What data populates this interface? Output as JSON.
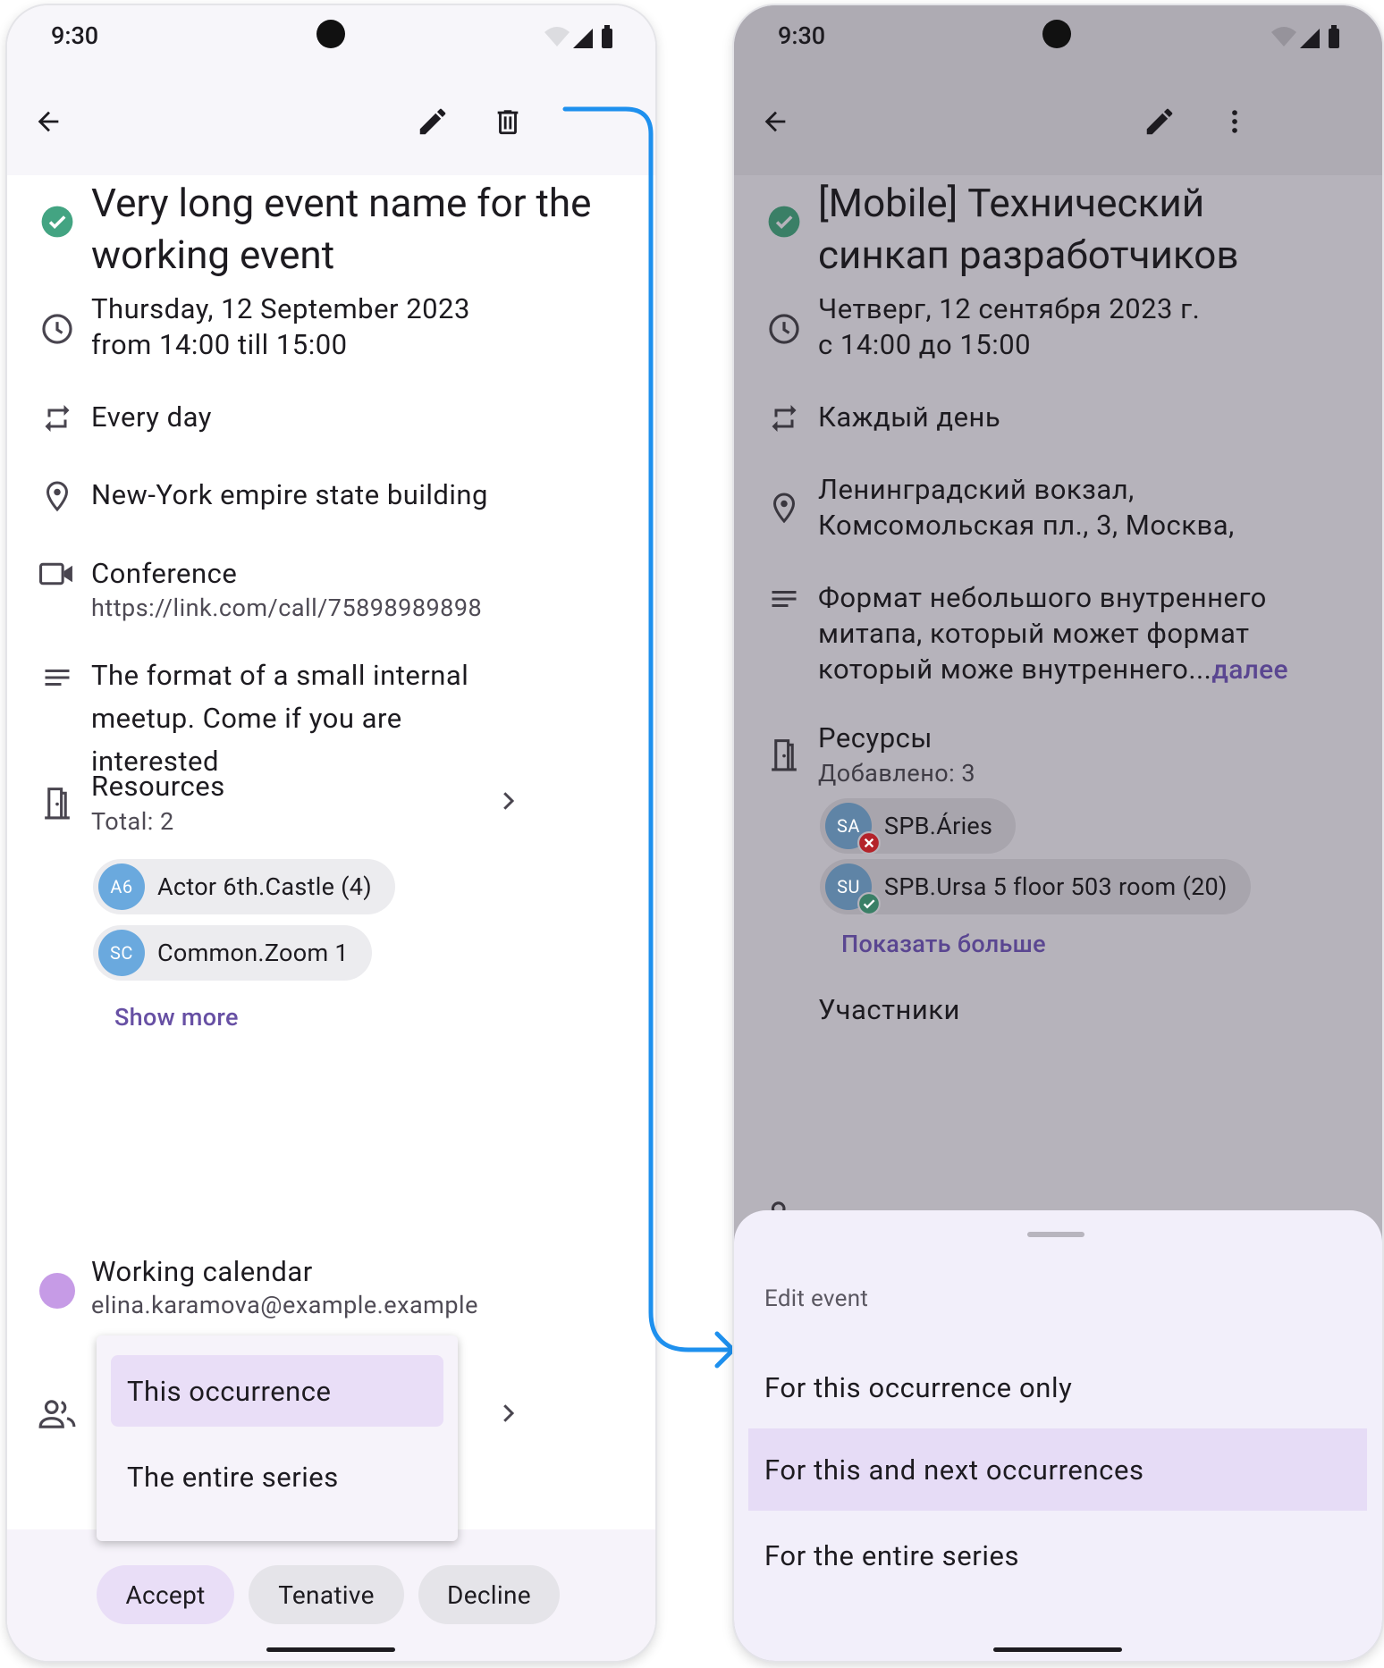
{
  "left": {
    "status_time": "9:30",
    "title": "Very long event name for the working event",
    "datetime_line1": "Thursday, 12 September 2023",
    "datetime_line2": "from 14:00 till 15:00",
    "recurrence": "Every day",
    "location": "New-York empire state building",
    "conference_label": "Conference",
    "conference_url": "https://link.com/call/75898989898",
    "description": "The format of a small internal meetup. Come if you are interested",
    "resources_title": "Resources",
    "resources_total": "Total: 2",
    "resources": [
      {
        "initials": "A6",
        "name": "Actor 6th.Castle (4)"
      },
      {
        "initials": "SC",
        "name": "Common.Zoom 1"
      }
    ],
    "show_more": "Show more",
    "calendar_name": "Working calendar",
    "calendar_email": "elina.karamova@example.example",
    "menu": [
      "This occurrence",
      "The entire series"
    ],
    "buttons": {
      "accept": "Accept",
      "tentative": "Tenative",
      "decline": "Decline"
    }
  },
  "right": {
    "status_time": "9:30",
    "title": "[Mobile] Технический синкап разработчиков",
    "datetime_line1": "Четверг, 12 сентября 2023 г.",
    "datetime_line2": "с 14:00 до 15:00",
    "recurrence": "Каждый день",
    "location_line1": "Ленинградский вокзал,",
    "location_line2": "Комсомольская пл., 3, Москва,",
    "description_line1": "Формат небольшого внутреннего",
    "description_line2": "митапа, который может формат",
    "description_line3": "который може  внутреннего...",
    "description_more": "далее",
    "resources_title": "Ресурсы",
    "resources_added": "Добавлено: 3",
    "resources": [
      {
        "initials": "SA",
        "name": "SPB.Áries",
        "status": "declined"
      },
      {
        "initials": "SU",
        "name": "SPB.Ursa 5 floor 503 room (20)",
        "status": "accepted"
      }
    ],
    "show_more": "Показать больше",
    "participants": "Участники",
    "sheet_title": "Edit event",
    "sheet_options": [
      "For this occurrence only",
      "For this and next occurrences",
      "For the entire series"
    ]
  },
  "colors": {
    "accent": "#6750a4",
    "check_green": "#43a482",
    "calendar_dot": "#c69be6",
    "arrow_blue": "#1e90ee",
    "selected_bg": "#e9def7"
  }
}
